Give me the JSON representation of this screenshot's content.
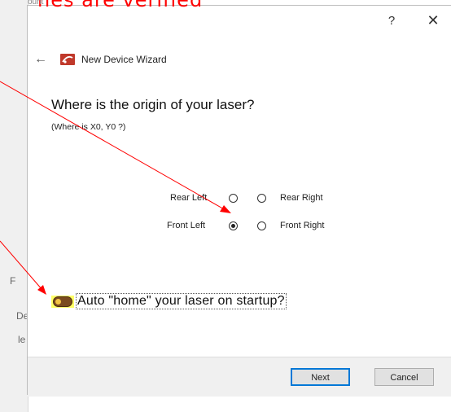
{
  "annotation": {
    "text": "nes are verified",
    "small_text": "ount"
  },
  "background": {
    "fragments": [
      "F",
      "De",
      "le"
    ]
  },
  "dialog": {
    "help_label": "?",
    "close_label": "✕",
    "back_icon": "arrow-left-icon",
    "wizard_title": "New Device Wizard",
    "question": "Where is the origin of your laser?",
    "subquestion": "(Where is X0, Y0 ?)",
    "origin_options": [
      {
        "label": "Rear Left",
        "checked": false
      },
      {
        "label": "Rear Right",
        "checked": false
      },
      {
        "label": "Front Left",
        "checked": true
      },
      {
        "label": "Front Right",
        "checked": false
      }
    ],
    "auto_home": {
      "label": "Auto \"home\" your laser on startup?",
      "enabled": true
    },
    "buttons": {
      "next": "Next",
      "cancel": "Cancel"
    }
  },
  "colors": {
    "annotation": "#ff0000",
    "highlight": "#ffff66",
    "toggle": "#7a4a1f"
  }
}
